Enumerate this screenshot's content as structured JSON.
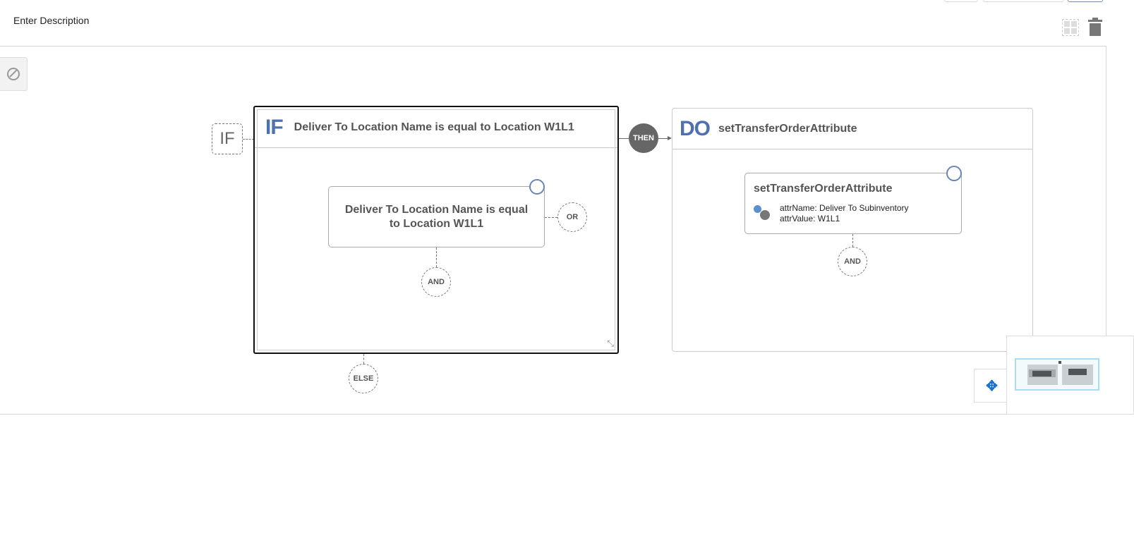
{
  "header": {
    "description_placeholder": "Enter Description"
  },
  "toolbar": {
    "layout_icon": "grid-layout-icon",
    "delete_icon": "trash-icon"
  },
  "canvas": {
    "compass_icon": "compass-icon",
    "if_label": "IF",
    "if_panel": {
      "keyword": "IF",
      "title": "Deliver To Location Name is equal to Location W1L1",
      "condition": "Deliver To Location Name is equal to Location W1L1",
      "or_label": "OR",
      "and_label": "AND"
    },
    "else_label": "ELSE",
    "then_label": "THEN",
    "do_panel": {
      "keyword": "DO",
      "title": "setTransferOrderAttribute",
      "action": {
        "name": "setTransferOrderAttribute",
        "attr_name": "attrName: Deliver To Subinventory",
        "attr_value": "attrValue: W1L1"
      },
      "and_label": "AND"
    }
  },
  "colors": {
    "accent": "#4f6fb3",
    "then": "#666666",
    "move": "#1a73c8"
  }
}
